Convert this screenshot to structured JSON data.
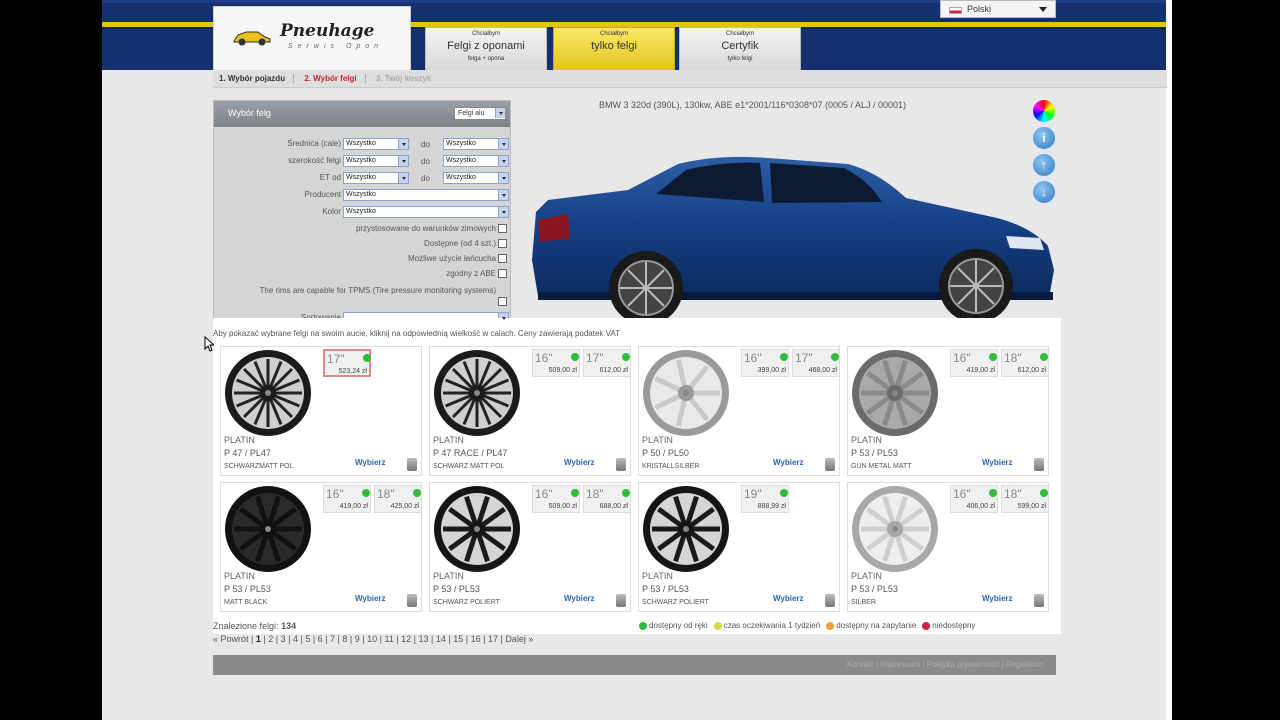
{
  "header": {
    "language": "Polski",
    "logo_name": "Pneuhage",
    "logo_sub": "Serwis Opon",
    "tabs": [
      {
        "small": "Chciałbym",
        "big": "Felgi z oponami",
        "foot": "felga + opona"
      },
      {
        "small": "Chciałbym",
        "big": "tylko felgi",
        "foot": ""
      },
      {
        "small": "Chciałbym",
        "big": "Certyfik",
        "foot": "tylko felgi"
      }
    ]
  },
  "steps": [
    "1. Wybór pojazdu",
    "2. Wybór felgi",
    "3. Twój koszyk"
  ],
  "filter": {
    "title": "Wybór felg",
    "type_select": "Felgi alu",
    "diameter_label": "Średnica (cale)",
    "width_label": "szerokość felgi",
    "et_label": "ET od",
    "to_label": "do",
    "all": "Wszystko",
    "producer_label": "Producent",
    "color_label": "Kolor",
    "winter_label": "przystosowane do warunków zimowych",
    "available_label": "Dostępne (od 4 szt.)",
    "chain_label": "Możliwe użycie łańcucha",
    "abe_label": "zgodny z ABE",
    "tpms_label": "The rims are capable for TPMS (Tire pressure monitoring systems)",
    "sort_label": "Sortowanie",
    "sort_value": ""
  },
  "vehicle": "BMW 3 320d (390L), 130kw, ABE e1*2001/116*0308*07 (0005 / ALJ / 00001)",
  "side_icons": [
    "color-wheel",
    "info",
    "up",
    "down"
  ],
  "info_text": "Aby pokazać wybrane felgi na swoim aucie, kliknij na odpowiednią wielkość w calach. Ceny zawierają podatek VAT",
  "choose_label": "Wybierz",
  "products": [
    {
      "brand": "PLATIN",
      "model": "P 47 / PL47",
      "color": "SCHWARZMATT POL",
      "style": "dark-multi",
      "sizes": [
        {
          "inch": "17\"",
          "price": "523,24 zł",
          "hl": true
        }
      ]
    },
    {
      "brand": "PLATIN",
      "model": "P 47 RACE / PL47",
      "color": "SCHWARZ MATT POL",
      "style": "dark-multi",
      "sizes": [
        {
          "inch": "16\"",
          "price": "509,00 zł"
        },
        {
          "inch": "17\"",
          "price": "612,00 zł"
        }
      ]
    },
    {
      "brand": "PLATIN",
      "model": "P 50 / PL50",
      "color": "KRISTALLSILBER",
      "style": "silver-7",
      "sizes": [
        {
          "inch": "16\"",
          "price": "399,00 zł"
        },
        {
          "inch": "17\"",
          "price": "468,00 zł"
        }
      ]
    },
    {
      "brand": "PLATIN",
      "model": "P 53 / PL53",
      "color": "GUN METAL MATT",
      "style": "gun-5",
      "sizes": [
        {
          "inch": "16\"",
          "price": "419,00 zł"
        },
        {
          "inch": "18\"",
          "price": "612,00 zł"
        }
      ]
    },
    {
      "brand": "PLATIN",
      "model": "P 53 / PL53",
      "color": "MATT BLACK",
      "style": "black-5",
      "sizes": [
        {
          "inch": "16\"",
          "price": "419,00 zł"
        },
        {
          "inch": "18\"",
          "price": "425,00 zł"
        }
      ]
    },
    {
      "brand": "PLATIN",
      "model": "P 53 / PL53",
      "color": "SCHWARZ POLIERT",
      "style": "polished-5",
      "sizes": [
        {
          "inch": "16\"",
          "price": "509,00 zł"
        },
        {
          "inch": "18\"",
          "price": "688,00 zł"
        }
      ]
    },
    {
      "brand": "PLATIN",
      "model": "P 53 / PL53",
      "color": "SCHWARZ POLIERT",
      "style": "polished-5",
      "sizes": [
        {
          "inch": "19\"",
          "price": "888,99 zł"
        }
      ]
    },
    {
      "brand": "PLATIN",
      "model": "P 53 / PL53",
      "color": "SILBER",
      "style": "silver-5",
      "sizes": [
        {
          "inch": "16\"",
          "price": "406,00 zł"
        },
        {
          "inch": "18\"",
          "price": "599,00 zł"
        }
      ]
    }
  ],
  "found_label": "Znalezione felgi:",
  "found_count": "134",
  "pager": {
    "prev": "« Powrót",
    "pages": [
      "1",
      "2",
      "3",
      "4",
      "5",
      "6",
      "7",
      "8",
      "9",
      "10",
      "11",
      "12",
      "13",
      "14",
      "15",
      "16",
      "17"
    ],
    "next": "Dalej »"
  },
  "legend": [
    {
      "label": "dostępny od ręki",
      "color": "#2fbd3a"
    },
    {
      "label": "czas oczekiwania 1 tydzień",
      "color": "#d8d84a"
    },
    {
      "label": "dostępny na zapytanie",
      "color": "#f0a23a"
    },
    {
      "label": "niedostępny",
      "color": "#d4213d"
    }
  ],
  "footer": "Kontakt | Impressum | Polityka prywatności | Regulamin"
}
